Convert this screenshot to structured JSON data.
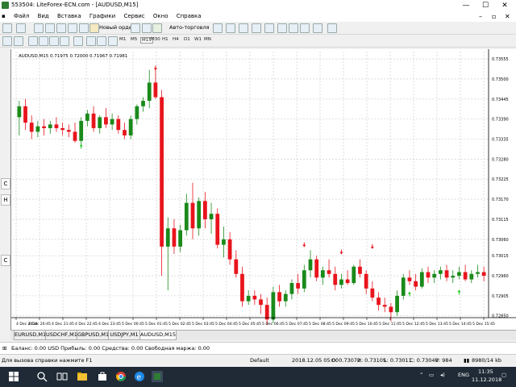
{
  "window": {
    "title": "553504: LiteForex-ECN.com - [AUDUSD,M15]",
    "minimize": "—",
    "maximize": "☐",
    "close": "✕"
  },
  "menu": {
    "items": [
      "Файл",
      "Вид",
      "Вставка",
      "Графики",
      "Сервис",
      "Окно",
      "Справка"
    ],
    "child_min": "–",
    "child_restore": "▫",
    "child_close": "✕"
  },
  "toolbar": {
    "new_order": "Новый ордер",
    "auto_trading": "Авто-торговля",
    "timeframes": [
      "M1",
      "M5",
      "M15",
      "M30",
      "H1",
      "H4",
      "D1",
      "W1",
      "MN"
    ]
  },
  "chart": {
    "symbol_header": "AUDUSD,M15  0.71975 0.72000 0.71967 0.71981",
    "side_tabs": [
      "C",
      "H",
      "C"
    ]
  },
  "chart_data": {
    "type": "candlestick",
    "symbol": "AUDUSD,M15",
    "ohlc_header": [
      0.71975,
      0.72,
      0.71967,
      0.71981
    ],
    "ylim": [
      0.72845,
      0.73575
    ],
    "y_ticks": [
      0.7285,
      0.72905,
      0.7296,
      0.73015,
      0.7306,
      0.73115,
      0.7317,
      0.73225,
      0.7328,
      0.73335,
      0.7339,
      0.73445,
      0.735,
      0.73555
    ],
    "x_labels": [
      "4 Dec 2018",
      "4 Dec 20:45",
      "4 Dec 21:45",
      "4 Dec 22:45",
      "4 Dec 23:45",
      "5 Dec 00:45",
      "5 Dec 01:45",
      "5 Dec 02:45",
      "5 Dec 03:45",
      "5 Dec 04:45",
      "5 Dec 05:45",
      "5 Dec 06:45",
      "5 Dec 07:45",
      "5 Dec 08:45",
      "5 Dec 09:45",
      "5 Dec 10:45",
      "5 Dec 11:45",
      "5 Dec 12:45",
      "5 Dec 13:45",
      "5 Dec 14:45",
      "5 Dec 15:45"
    ],
    "bull_color": "#1a8a1a",
    "bear_color": "#e8141c",
    "grid": true,
    "candles": [
      {
        "o": 0.73395,
        "h": 0.7344,
        "l": 0.73345,
        "c": 0.73425
      },
      {
        "o": 0.73425,
        "h": 0.73445,
        "l": 0.7336,
        "c": 0.7338
      },
      {
        "o": 0.7338,
        "h": 0.734,
        "l": 0.73335,
        "c": 0.73355
      },
      {
        "o": 0.73355,
        "h": 0.73385,
        "l": 0.7334,
        "c": 0.7337
      },
      {
        "o": 0.7337,
        "h": 0.7339,
        "l": 0.73345,
        "c": 0.73365
      },
      {
        "o": 0.73365,
        "h": 0.73385,
        "l": 0.7335,
        "c": 0.73375
      },
      {
        "o": 0.73375,
        "h": 0.73395,
        "l": 0.73355,
        "c": 0.73365
      },
      {
        "o": 0.73365,
        "h": 0.7338,
        "l": 0.73345,
        "c": 0.7336
      },
      {
        "o": 0.7336,
        "h": 0.73375,
        "l": 0.7334,
        "c": 0.73355
      },
      {
        "o": 0.73355,
        "h": 0.7338,
        "l": 0.73325,
        "c": 0.7333
      },
      {
        "o": 0.7333,
        "h": 0.73395,
        "l": 0.7332,
        "c": 0.73385
      },
      {
        "o": 0.73385,
        "h": 0.73415,
        "l": 0.7337,
        "c": 0.73405
      },
      {
        "o": 0.73405,
        "h": 0.73425,
        "l": 0.73355,
        "c": 0.73365
      },
      {
        "o": 0.73365,
        "h": 0.734,
        "l": 0.7335,
        "c": 0.73395
      },
      {
        "o": 0.73395,
        "h": 0.7342,
        "l": 0.73365,
        "c": 0.73375
      },
      {
        "o": 0.73375,
        "h": 0.73405,
        "l": 0.7336,
        "c": 0.7339
      },
      {
        "o": 0.7339,
        "h": 0.734,
        "l": 0.7335,
        "c": 0.7336
      },
      {
        "o": 0.7336,
        "h": 0.7338,
        "l": 0.73335,
        "c": 0.73345
      },
      {
        "o": 0.73345,
        "h": 0.734,
        "l": 0.73335,
        "c": 0.7339
      },
      {
        "o": 0.7339,
        "h": 0.7343,
        "l": 0.73375,
        "c": 0.73425
      },
      {
        "o": 0.73425,
        "h": 0.7345,
        "l": 0.7341,
        "c": 0.7344
      },
      {
        "o": 0.7344,
        "h": 0.73525,
        "l": 0.7342,
        "c": 0.7349
      },
      {
        "o": 0.7349,
        "h": 0.7353,
        "l": 0.73445,
        "c": 0.7345
      },
      {
        "o": 0.7345,
        "h": 0.7347,
        "l": 0.7296,
        "c": 0.7304
      },
      {
        "o": 0.7304,
        "h": 0.7312,
        "l": 0.7292,
        "c": 0.7309
      },
      {
        "o": 0.7309,
        "h": 0.73115,
        "l": 0.7302,
        "c": 0.7304
      },
      {
        "o": 0.7304,
        "h": 0.731,
        "l": 0.73025,
        "c": 0.73085
      },
      {
        "o": 0.73085,
        "h": 0.73185,
        "l": 0.7307,
        "c": 0.7316
      },
      {
        "o": 0.7316,
        "h": 0.73215,
        "l": 0.7306,
        "c": 0.7309
      },
      {
        "o": 0.7309,
        "h": 0.73175,
        "l": 0.7307,
        "c": 0.73165
      },
      {
        "o": 0.73165,
        "h": 0.7319,
        "l": 0.7309,
        "c": 0.73115
      },
      {
        "o": 0.73115,
        "h": 0.7316,
        "l": 0.73075,
        "c": 0.7313
      },
      {
        "o": 0.7313,
        "h": 0.73145,
        "l": 0.73035,
        "c": 0.73045
      },
      {
        "o": 0.73045,
        "h": 0.73095,
        "l": 0.7301,
        "c": 0.7306
      },
      {
        "o": 0.7306,
        "h": 0.7308,
        "l": 0.7299,
        "c": 0.73005
      },
      {
        "o": 0.73005,
        "h": 0.7303,
        "l": 0.72955,
        "c": 0.72965
      },
      {
        "o": 0.72965,
        "h": 0.72985,
        "l": 0.72875,
        "c": 0.7289
      },
      {
        "o": 0.7289,
        "h": 0.7292,
        "l": 0.7288,
        "c": 0.72905
      },
      {
        "o": 0.72905,
        "h": 0.7292,
        "l": 0.7288,
        "c": 0.72895
      },
      {
        "o": 0.72895,
        "h": 0.7291,
        "l": 0.72855,
        "c": 0.7288
      },
      {
        "o": 0.7288,
        "h": 0.729,
        "l": 0.72825,
        "c": 0.7284
      },
      {
        "o": 0.7284,
        "h": 0.7293,
        "l": 0.7283,
        "c": 0.72915
      },
      {
        "o": 0.72915,
        "h": 0.72935,
        "l": 0.72875,
        "c": 0.7289
      },
      {
        "o": 0.7289,
        "h": 0.7292,
        "l": 0.72875,
        "c": 0.7291
      },
      {
        "o": 0.7291,
        "h": 0.7295,
        "l": 0.72895,
        "c": 0.7294
      },
      {
        "o": 0.7294,
        "h": 0.72965,
        "l": 0.7291,
        "c": 0.72925
      },
      {
        "o": 0.72925,
        "h": 0.7299,
        "l": 0.72915,
        "c": 0.72975
      },
      {
        "o": 0.72975,
        "h": 0.7303,
        "l": 0.72955,
        "c": 0.73005
      },
      {
        "o": 0.73005,
        "h": 0.73015,
        "l": 0.72945,
        "c": 0.72955
      },
      {
        "o": 0.72955,
        "h": 0.72985,
        "l": 0.72935,
        "c": 0.72975
      },
      {
        "o": 0.72975,
        "h": 0.73005,
        "l": 0.72955,
        "c": 0.72965
      },
      {
        "o": 0.72965,
        "h": 0.72985,
        "l": 0.7292,
        "c": 0.72935
      },
      {
        "o": 0.72935,
        "h": 0.72965,
        "l": 0.72925,
        "c": 0.7295
      },
      {
        "o": 0.7295,
        "h": 0.72975,
        "l": 0.72935,
        "c": 0.7294
      },
      {
        "o": 0.7294,
        "h": 0.7299,
        "l": 0.72935,
        "c": 0.72985
      },
      {
        "o": 0.72985,
        "h": 0.73005,
        "l": 0.72955,
        "c": 0.72965
      },
      {
        "o": 0.72965,
        "h": 0.72975,
        "l": 0.7291,
        "c": 0.72925
      },
      {
        "o": 0.72925,
        "h": 0.72945,
        "l": 0.7289,
        "c": 0.729
      },
      {
        "o": 0.729,
        "h": 0.72915,
        "l": 0.72865,
        "c": 0.7288
      },
      {
        "o": 0.7288,
        "h": 0.729,
        "l": 0.7286,
        "c": 0.72875
      },
      {
        "o": 0.72875,
        "h": 0.72885,
        "l": 0.72835,
        "c": 0.7286
      },
      {
        "o": 0.7286,
        "h": 0.7292,
        "l": 0.7285,
        "c": 0.72905
      },
      {
        "o": 0.72905,
        "h": 0.72965,
        "l": 0.72895,
        "c": 0.72955
      },
      {
        "o": 0.72955,
        "h": 0.72975,
        "l": 0.72935,
        "c": 0.72945
      },
      {
        "o": 0.72945,
        "h": 0.72965,
        "l": 0.7292,
        "c": 0.7293
      },
      {
        "o": 0.7293,
        "h": 0.7298,
        "l": 0.72925,
        "c": 0.7297
      },
      {
        "o": 0.7297,
        "h": 0.72985,
        "l": 0.7294,
        "c": 0.72955
      },
      {
        "o": 0.72955,
        "h": 0.72975,
        "l": 0.7294,
        "c": 0.72965
      },
      {
        "o": 0.72965,
        "h": 0.72985,
        "l": 0.7295,
        "c": 0.72975
      },
      {
        "o": 0.72975,
        "h": 0.7299,
        "l": 0.72945,
        "c": 0.72955
      },
      {
        "o": 0.72955,
        "h": 0.72975,
        "l": 0.7294,
        "c": 0.7296
      },
      {
        "o": 0.7296,
        "h": 0.72985,
        "l": 0.7295,
        "c": 0.7297
      },
      {
        "o": 0.7297,
        "h": 0.7299,
        "l": 0.72945,
        "c": 0.7295
      },
      {
        "o": 0.7295,
        "h": 0.72975,
        "l": 0.7294,
        "c": 0.72965
      },
      {
        "o": 0.72965,
        "h": 0.7299,
        "l": 0.72955,
        "c": 0.7297
      },
      {
        "o": 0.7297,
        "h": 0.72985,
        "l": 0.72945,
        "c": 0.7296
      }
    ],
    "arrows": [
      {
        "index": 10,
        "dir": "up",
        "price": 0.73315
      },
      {
        "index": 22,
        "dir": "down",
        "price": 0.7353
      },
      {
        "index": 46,
        "dir": "down",
        "price": 0.73045
      },
      {
        "index": 52,
        "dir": "down",
        "price": 0.73025
      },
      {
        "index": 57,
        "dir": "down",
        "price": 0.7304
      },
      {
        "index": 63,
        "dir": "up",
        "price": 0.7291
      },
      {
        "index": 71,
        "dir": "up",
        "price": 0.72915
      }
    ]
  },
  "tabs": {
    "items": [
      "EURUSD,M1",
      "USDCHF,M1",
      "GBPUSD,M1",
      "USDJPY,M1",
      "AUDUSD,M15"
    ],
    "active_index": 4
  },
  "balance": {
    "text": "Баланс: 0.00 USD  Прибыль: 0.00  Средства: 0.00  Свободная маржа: 0.00"
  },
  "status": {
    "help": "Для вызова справки нажмите F1",
    "profile": "Default",
    "time": "2018.12.05 05:00",
    "open": "O: 0.73072",
    "high": "H: 0.73105",
    "low": "L: 0.73011",
    "close": "C: 0.73040",
    "volume": "V: 984",
    "traffic": "8980/14 kb"
  },
  "taskbar": {
    "lang": "ENG",
    "clock_time": "11:35",
    "clock_date": "11.12.2018"
  }
}
